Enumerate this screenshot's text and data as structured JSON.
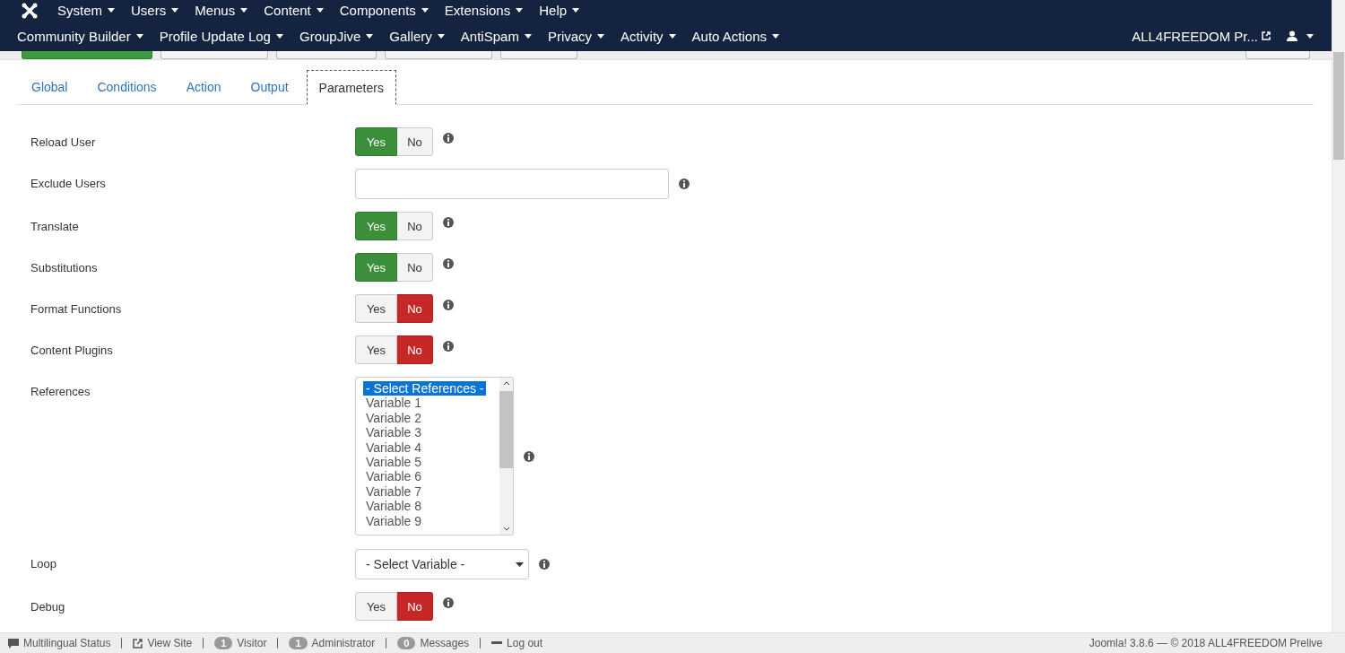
{
  "menu_bar": {
    "main_menu": [
      "System",
      "Users",
      "Menus",
      "Content",
      "Components",
      "Extensions",
      "Help"
    ],
    "component_menu": [
      "Community Builder",
      "Profile Update Log",
      "GroupJive",
      "Gallery",
      "AntiSpam",
      "Privacy",
      "Activity",
      "Auto Actions"
    ],
    "site_link": "ALL4FREEDOM Pr..."
  },
  "tabs": [
    {
      "label": "Global",
      "selected": false
    },
    {
      "label": "Conditions",
      "selected": false
    },
    {
      "label": "Action",
      "selected": false
    },
    {
      "label": "Output",
      "selected": false
    },
    {
      "label": "Parameters",
      "selected": true
    }
  ],
  "fields": [
    {
      "kind": "toggle",
      "label": "Reload User",
      "options": [
        {
          "label": "Yes",
          "selected": true
        },
        {
          "label": "No",
          "selected": false
        }
      ]
    },
    {
      "kind": "text",
      "label": "Exclude Users"
    },
    {
      "kind": "toggle",
      "label": "Translate",
      "options": [
        {
          "label": "Yes",
          "selected": true
        },
        {
          "label": "No",
          "selected": false
        }
      ]
    },
    {
      "kind": "toggle",
      "label": "Substitutions",
      "options": [
        {
          "label": "Yes",
          "selected": true
        },
        {
          "label": "No",
          "selected": false
        }
      ]
    },
    {
      "kind": "toggle",
      "label": "Format Functions",
      "options": [
        {
          "label": "Yes",
          "selected": false
        },
        {
          "label": "No",
          "selected": true
        }
      ]
    },
    {
      "kind": "toggle",
      "label": "Content Plugins",
      "options": [
        {
          "label": "Yes",
          "selected": false
        },
        {
          "label": "No",
          "selected": true
        }
      ]
    },
    {
      "kind": "listbox",
      "label": "References",
      "items": [
        {
          "label": "- Select References -",
          "selected": true
        },
        {
          "label": "Variable 1",
          "selected": false
        },
        {
          "label": "Variable 2",
          "selected": false
        },
        {
          "label": "Variable 3",
          "selected": false
        },
        {
          "label": "Variable 4",
          "selected": false
        },
        {
          "label": "Variable 5",
          "selected": false
        },
        {
          "label": "Variable 6",
          "selected": false
        },
        {
          "label": "Variable 7",
          "selected": false
        },
        {
          "label": "Variable 8",
          "selected": false
        },
        {
          "label": "Variable 9",
          "selected": false
        }
      ]
    },
    {
      "kind": "select",
      "label": "Loop",
      "value": "- Select Variable -"
    },
    {
      "kind": "toggle",
      "label": "Debug",
      "options": [
        {
          "label": "Yes",
          "selected": false
        },
        {
          "label": "No",
          "selected": true
        }
      ]
    }
  ],
  "status_bar": {
    "items": [
      {
        "kind": "language",
        "label": "Multilingual Status"
      },
      {
        "kind": "link",
        "label": "View Site"
      },
      {
        "kind": "count",
        "count": "1",
        "label": "Visitor"
      },
      {
        "kind": "count",
        "count": "1",
        "label": "Administrator"
      },
      {
        "kind": "count",
        "count": "0",
        "label": "Messages"
      },
      {
        "kind": "logout",
        "label": "Log out"
      }
    ],
    "version": "Joomla! 3.8.6 — © 2018 ALL4FREEDOM Prelive"
  }
}
